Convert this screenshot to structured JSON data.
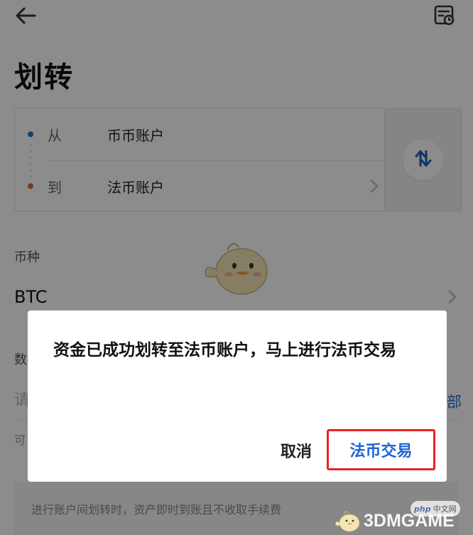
{
  "header": {
    "back_icon": "arrow-left-icon",
    "record_icon": "transfer-record-icon",
    "title": "划转"
  },
  "transfer": {
    "from_label": "从",
    "from_account": "币币账户",
    "to_label": "到",
    "to_account": "法币账户",
    "swap_icon": "swap-vertical-icon",
    "from_dot_color": "#2a6fd0",
    "to_dot_color": "#e2643a"
  },
  "currency": {
    "label": "币种",
    "value": "BTC"
  },
  "amount": {
    "label": "数",
    "placeholder": "请",
    "all_label": "部",
    "available_label": "可"
  },
  "fee_note": "进行账户间划转时，资产即时到账且不收取手续费",
  "dialog": {
    "message": "资金已成功划转至法币账户，马上进行法币交易",
    "cancel_label": "取消",
    "confirm_label": "法币交易",
    "confirm_color": "#1f63d6",
    "highlight_color": "#e52421"
  },
  "watermark": {
    "php_text": "php",
    "cn_text": "中文网",
    "site_text": "3DMGAME"
  }
}
